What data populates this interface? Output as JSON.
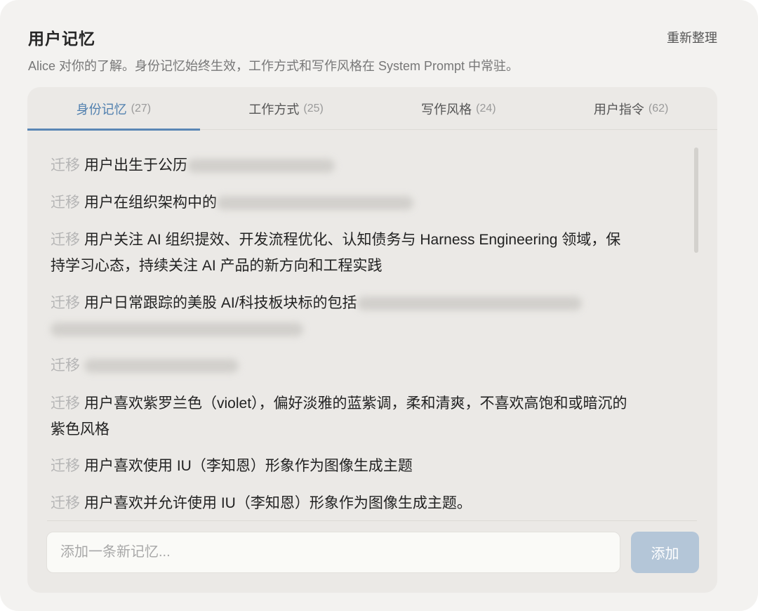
{
  "header": {
    "title": "用户记忆",
    "reorganize_label": "重新整理",
    "subtitle": "Alice 对你的了解。身份记忆始终生效，工作方式和写作风格在 System Prompt 中常驻。"
  },
  "tabs": [
    {
      "label": "身份记忆",
      "count": "(27)",
      "active": true
    },
    {
      "label": "工作方式",
      "count": "(25)",
      "active": false
    },
    {
      "label": "写作风格",
      "count": "(24)",
      "active": false
    },
    {
      "label": "用户指令",
      "count": "(62)",
      "active": false
    }
  ],
  "memories": [
    {
      "tag": "迁移",
      "text": "用户出生于公历"
    },
    {
      "tag": "迁移",
      "text": "用户在组织架构中的"
    },
    {
      "tag": "迁移",
      "text": "用户关注 AI 组织提效、开发流程优化、认知债务与 Harness Engineering 领域，保持学习心态，持续关注 AI 产品的新方向和工程实践"
    },
    {
      "tag": "迁移",
      "text": "用户日常跟踪的美股 AI/科技板块标的包括"
    },
    {
      "tag": "迁移",
      "text": ""
    },
    {
      "tag": "迁移",
      "text": "用户喜欢紫罗兰色（violet），偏好淡雅的蓝紫调，柔和清爽，不喜欢高饱和或暗沉的紫色风格"
    },
    {
      "tag": "迁移",
      "text": "用户喜欢使用 IU（李知恩）形象作为图像生成主题"
    },
    {
      "tag": "迁移",
      "text": "用户喜欢并允许使用 IU（李知恩）形象作为图像生成主题。"
    }
  ],
  "composer": {
    "placeholder": "添加一条新记忆...",
    "add_label": "添加"
  },
  "colors": {
    "accent": "#5a87b5",
    "add_button": "#b4c6d8",
    "background": "#f3f2f0",
    "panel": "#ebe9e6"
  }
}
